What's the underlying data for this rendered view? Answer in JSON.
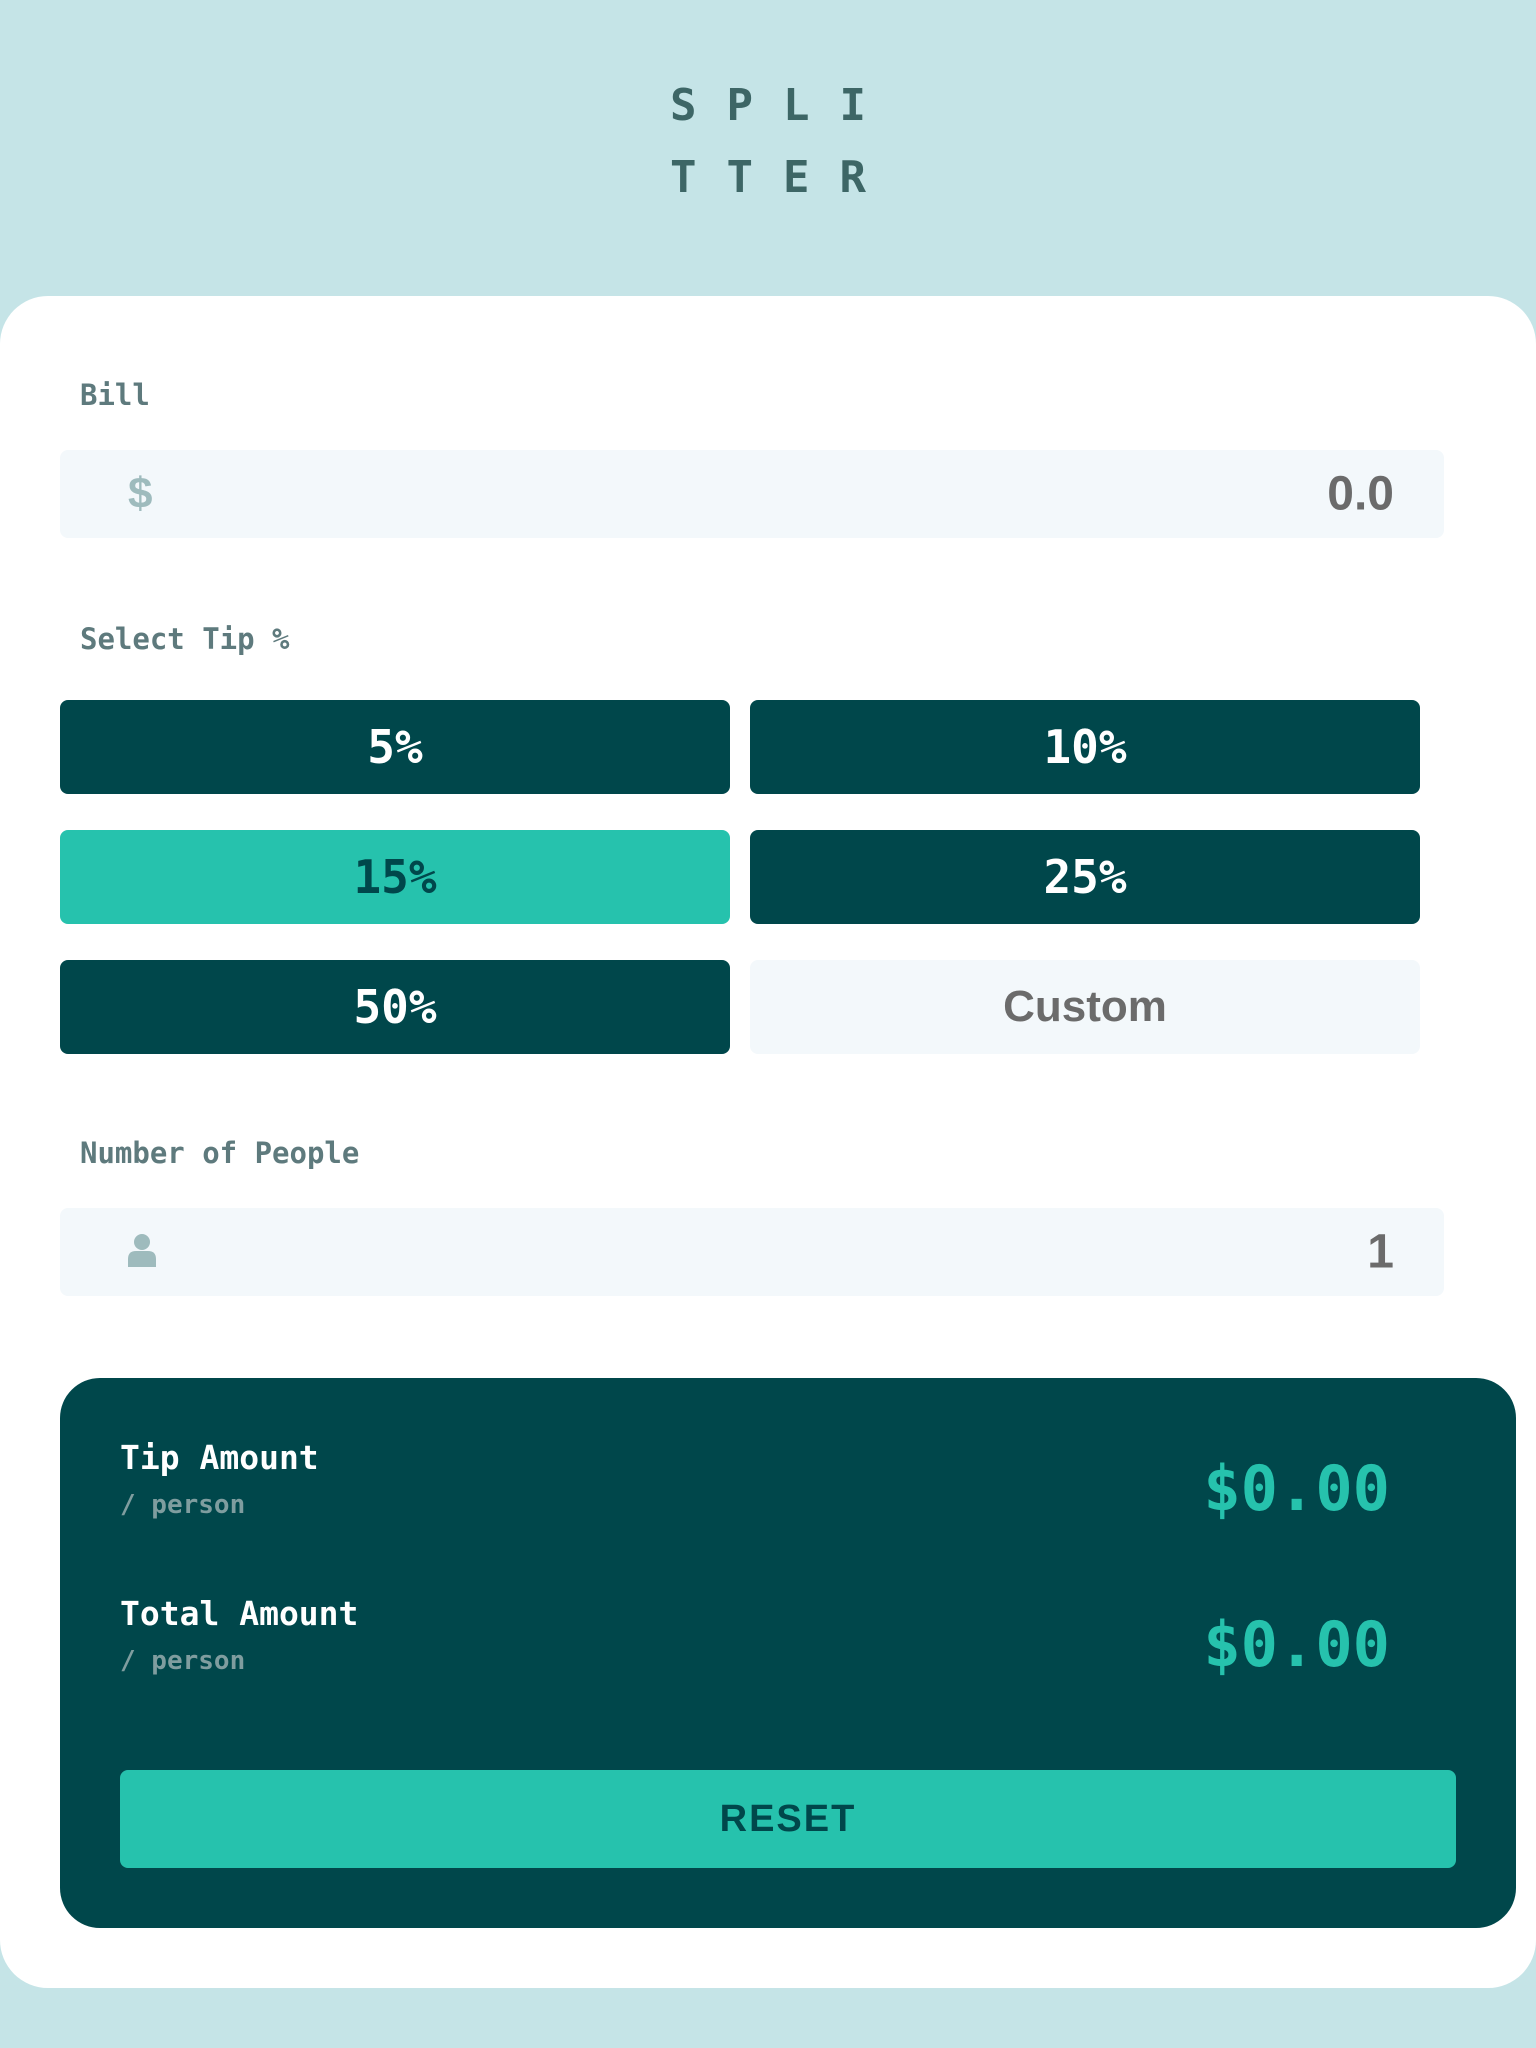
{
  "logo": {
    "line1": "SPLI",
    "line2": "TTER"
  },
  "bill": {
    "label": "Bill",
    "currency_symbol": "$",
    "value": "0.0"
  },
  "tip": {
    "label": "Select Tip %",
    "options": [
      {
        "label": "5%"
      },
      {
        "label": "10%"
      },
      {
        "label": "15%",
        "selected": true
      },
      {
        "label": "25%"
      },
      {
        "label": "50%"
      }
    ],
    "custom_placeholder": "Custom"
  },
  "people": {
    "label": "Number of People",
    "icon": "person-icon",
    "value": "1"
  },
  "results": {
    "tip_title": "Tip Amount",
    "tip_sub": "/ person",
    "tip_value": "$0.00",
    "total_title": "Total Amount",
    "total_sub": "/ person",
    "total_value": "$0.00",
    "reset_label": "RESET"
  },
  "colors": {
    "background": "#c5e4e7",
    "dark_cyan": "#00474b",
    "strong_cyan": "#26c2ad",
    "input_bg": "#f3f8fb"
  }
}
